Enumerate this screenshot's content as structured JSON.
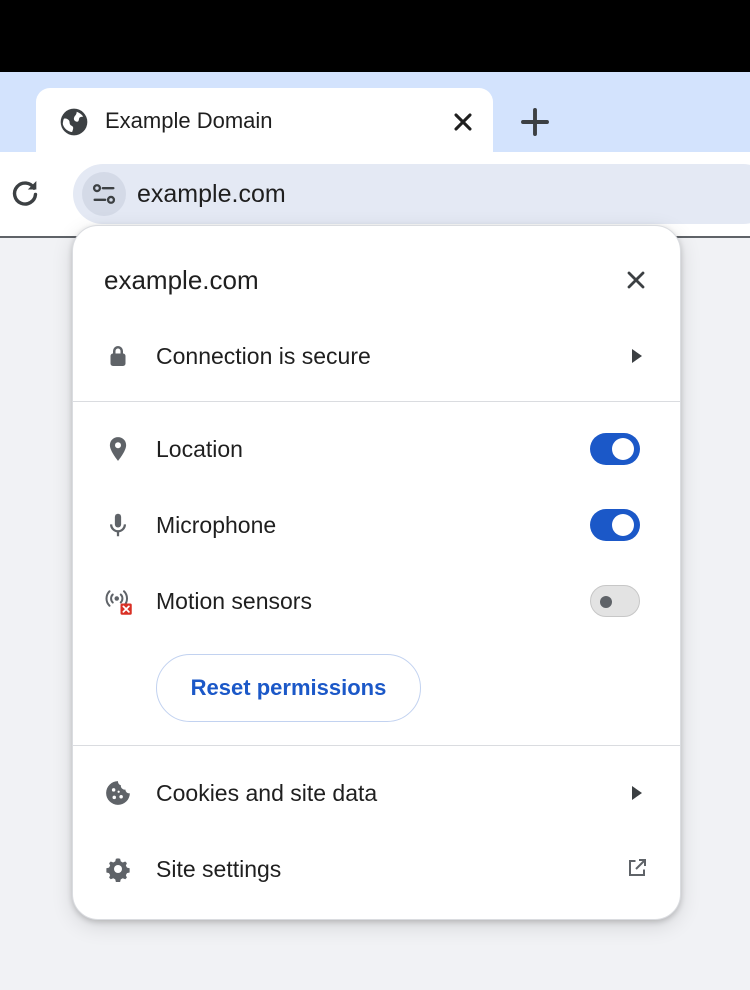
{
  "browser": {
    "tab": {
      "title": "Example Domain",
      "icon": "globe-icon"
    },
    "new_tab_icon": "plus-icon",
    "reload_icon": "reload-icon",
    "site_info_icon": "tune-icon",
    "url": "example.com"
  },
  "popup": {
    "title": "example.com",
    "close_icon": "close-icon",
    "connection": {
      "label": "Connection is secure",
      "icon": "lock-icon"
    },
    "permissions": [
      {
        "label": "Location",
        "icon": "location-pin-icon",
        "enabled": true
      },
      {
        "label": "Microphone",
        "icon": "microphone-icon",
        "enabled": true
      },
      {
        "label": "Motion sensors",
        "icon": "sensors-blocked-icon",
        "enabled": false
      }
    ],
    "reset_label": "Reset permissions",
    "cookies": {
      "label": "Cookies and site data",
      "icon": "cookie-icon"
    },
    "site_settings": {
      "label": "Site settings",
      "icon": "gear-icon",
      "trailing_icon": "open-in-new-icon"
    }
  },
  "colors": {
    "accent": "#1b58c8",
    "tabstrip": "#d3e3fd",
    "omnibox": "#e4e9f4",
    "icon_gray": "#5f6368"
  }
}
